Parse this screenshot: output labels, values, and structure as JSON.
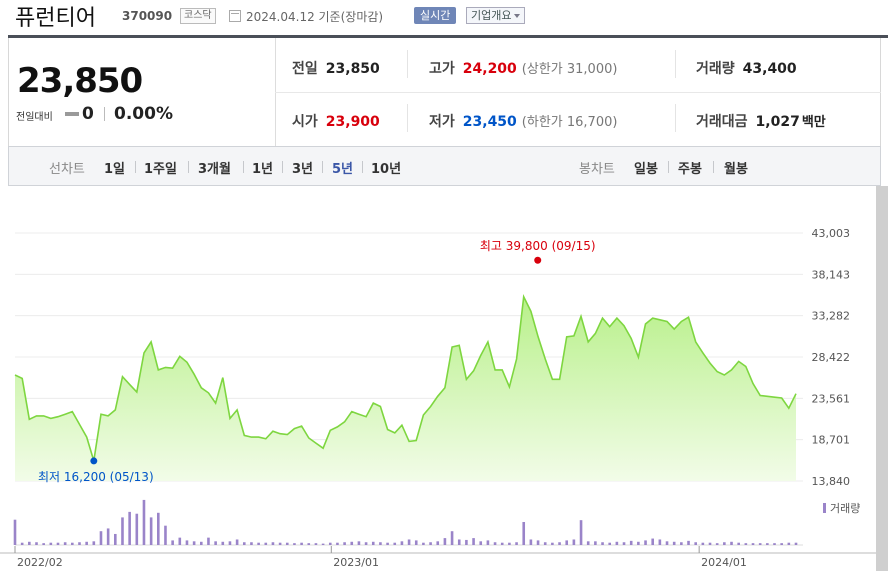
{
  "header": {
    "stock_name": "퓨런티어",
    "stock_code": "370090",
    "market_badge": "코스닥",
    "as_of": "2024.04.12  기준(장마감)",
    "realtime_button": "실시간",
    "overview_button": "기업개요"
  },
  "price": {
    "current": "23,850",
    "change_label": "전일대비",
    "change_points": "0",
    "change_percent": "0.00%"
  },
  "fields": {
    "prev_close_label": "전일",
    "prev_close": "23,850",
    "high_label": "고가",
    "high": "24,200",
    "upper_limit_label": "(상한가 31,000)",
    "volume_label": "거래량",
    "volume": "43,400",
    "open_label": "시가",
    "open": "23,900",
    "low_label": "저가",
    "low": "23,450",
    "lower_limit_label": "(하한가 16,700)",
    "trade_value_label": "거래대금",
    "trade_value": "1,027",
    "trade_value_unit": "백만"
  },
  "tabs": {
    "line_label": "선차트",
    "periods": [
      "1일",
      "1주일",
      "3개월",
      "1년",
      "3년",
      "5년",
      "10년"
    ],
    "active_period": "5년",
    "candle_label": "봉차트",
    "candles": [
      "일봉",
      "주봉",
      "월봉"
    ]
  },
  "colors": {
    "up": "#d8000c",
    "down": "#0055c8",
    "line": "#7ed640",
    "fill_top": "#b8f08a",
    "fill_bottom": "#f2fce8",
    "volume": "#9a84c9",
    "tab_active": "#3b57a7"
  },
  "chart_data": {
    "type": "area",
    "y_ticks": [
      "43,003",
      "38,143",
      "33,282",
      "28,422",
      "23,561",
      "18,701",
      "13,840"
    ],
    "ylim": [
      13840,
      43003
    ],
    "x_labels": [
      "2022/02",
      "2023/01",
      "2024/01"
    ],
    "max_annotation": "최고 39,800 (09/15)",
    "min_annotation": "최저 16,200 (05/13)",
    "max_value": 39800,
    "min_value": 16200,
    "volume_label": "거래량",
    "series": [
      {
        "values": [
          26300,
          25900,
          21100,
          21500,
          21500,
          21200,
          21400,
          21700,
          22000,
          20500,
          19000,
          16200,
          21700,
          21500,
          22200,
          26100,
          25200,
          24300,
          28900,
          30200,
          26900,
          27200,
          27100,
          28500,
          27800,
          26400,
          24800,
          24200,
          23000,
          26000,
          21200,
          22200,
          19200,
          19000,
          19000,
          18800,
          19700,
          19400,
          19300,
          20000,
          20300,
          18900,
          18300,
          17700,
          19800,
          20200,
          20800,
          22000,
          21700,
          21400,
          23000,
          22600,
          19900,
          19500,
          20400,
          18500,
          18600,
          21600,
          22600,
          23800,
          24800,
          29600,
          29800,
          25800,
          26800,
          28600,
          30200,
          26900,
          26900,
          24900,
          28200,
          35500,
          33800,
          30800,
          28200,
          25800,
          25800,
          30800,
          30900,
          33200,
          30200,
          31200,
          33000,
          32000,
          33000,
          32100,
          30600,
          28400,
          32300,
          33000,
          32800,
          32600,
          31700,
          32600,
          33100,
          30200,
          28900,
          27700,
          26700,
          26300,
          26900,
          27900,
          27300,
          25300,
          23900,
          23800,
          23700,
          23600,
          22400,
          24100
        ]
      }
    ],
    "volume": [
      0.55,
      0.05,
      0.07,
      0.06,
      0.04,
      0.05,
      0.05,
      0.06,
      0.05,
      0.06,
      0.07,
      0.08,
      0.3,
      0.36,
      0.24,
      0.6,
      0.72,
      0.68,
      0.98,
      0.6,
      0.7,
      0.42,
      0.1,
      0.16,
      0.1,
      0.08,
      0.07,
      0.16,
      0.08,
      0.07,
      0.08,
      0.12,
      0.06,
      0.06,
      0.05,
      0.05,
      0.06,
      0.05,
      0.05,
      0.04,
      0.05,
      0.04,
      0.04,
      0.03,
      0.05,
      0.05,
      0.06,
      0.07,
      0.08,
      0.06,
      0.07,
      0.06,
      0.05,
      0.05,
      0.08,
      0.12,
      0.1,
      0.05,
      0.06,
      0.08,
      0.15,
      0.3,
      0.12,
      0.11,
      0.15,
      0.08,
      0.1,
      0.06,
      0.05,
      0.05,
      0.06,
      0.5,
      0.12,
      0.1,
      0.06,
      0.05,
      0.06,
      0.1,
      0.12,
      0.54,
      0.08,
      0.08,
      0.06,
      0.05,
      0.07,
      0.06,
      0.09,
      0.07,
      0.1,
      0.14,
      0.12,
      0.08,
      0.07,
      0.06,
      0.09,
      0.06,
      0.05,
      0.05,
      0.04,
      0.06,
      0.07,
      0.05,
      0.04,
      0.04,
      0.04,
      0.04,
      0.04,
      0.04,
      0.05,
      0.05
    ]
  }
}
